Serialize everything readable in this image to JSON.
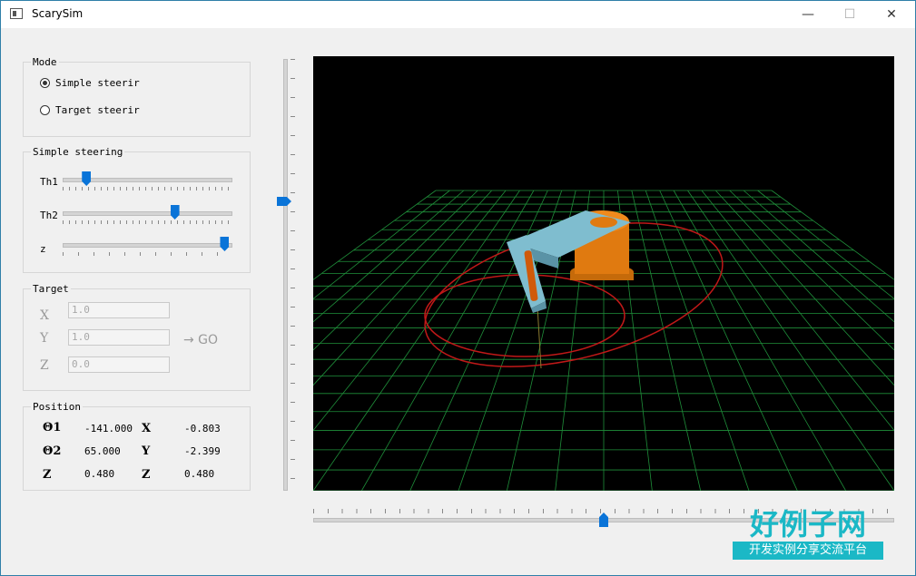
{
  "window": {
    "title": "ScarySim",
    "minimize": "—",
    "maximize": "☐",
    "close": "✕"
  },
  "mode": {
    "title": "Mode",
    "options": [
      {
        "label": "Simple steerir",
        "checked": true
      },
      {
        "label": "Target steerir",
        "checked": false
      }
    ]
  },
  "simple_steering": {
    "title": "Simple steering",
    "sliders": [
      {
        "label": "Th1",
        "level": 0.12
      },
      {
        "label": "Th2",
        "level": 0.67
      },
      {
        "label": "z",
        "level": 0.98
      }
    ]
  },
  "target": {
    "title": "Target",
    "x_label": "X",
    "x_value": "1.0",
    "y_label": "Y",
    "y_value": "1.0",
    "z_label": "Z",
    "z_value": "0.0",
    "go_label": "→ GO"
  },
  "position": {
    "title": "Position",
    "theta1_label": "Θ1",
    "theta1_value": "-141.000",
    "theta2_label": "Θ2",
    "theta2_value": "65.000",
    "z_label": "Z",
    "z_value": "0.480",
    "x_label": "X",
    "x_value": "-0.803",
    "y_label": "Y",
    "y_value": "-2.399",
    "z2_label": "Z",
    "z2_value": "0.480"
  },
  "view_controls": {
    "vertical_slider_level": 0.68,
    "horizontal_slider_level": 0.5
  },
  "watermark": {
    "main": "好例子网",
    "sub": "开发实例分享交流平台"
  },
  "colors": {
    "accent": "#0a74d8",
    "grid": "#1f8f3a",
    "path": "#c01818",
    "arm": "#7fbdcf",
    "base": "#e07a10"
  }
}
